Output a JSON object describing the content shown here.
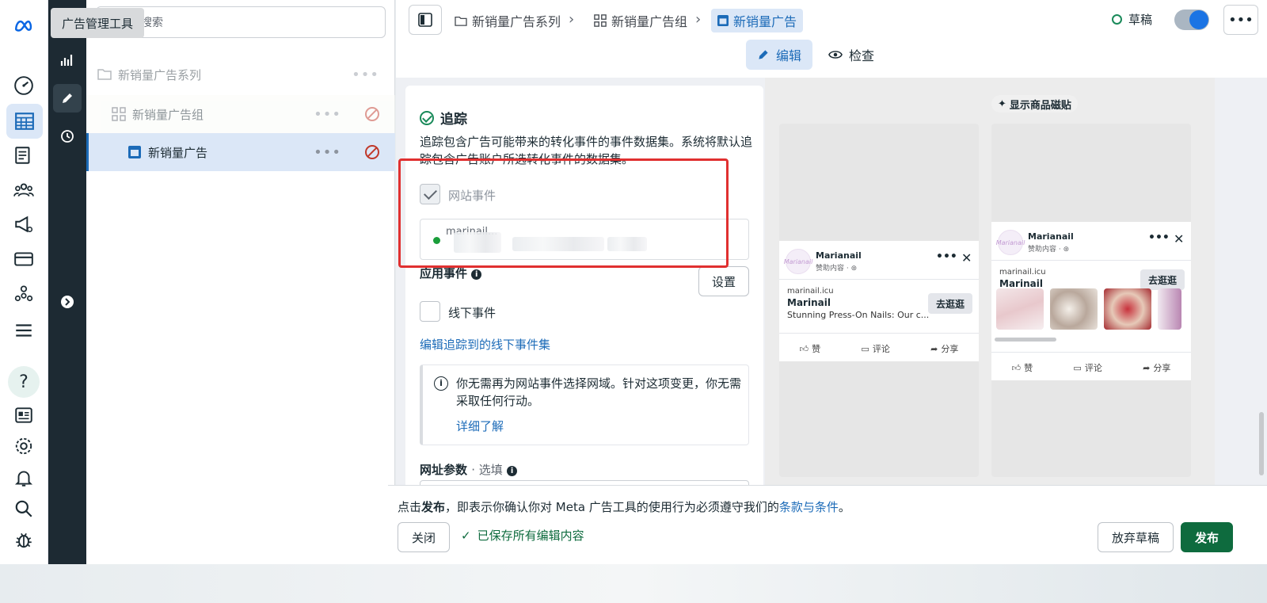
{
  "tooltip": "广告管理工具",
  "search": {
    "placeholder": "搜索"
  },
  "tree": {
    "campaign": "新销量广告系列",
    "adset": "新销量广告组",
    "ad": "新销量广告",
    "dots": "•••"
  },
  "breadcrumb": {
    "campaign": "新销量广告系列",
    "adset": "新销量广告组",
    "ad": "新销量广告"
  },
  "status": {
    "label": "草稿"
  },
  "more_label": "•••",
  "mode_tabs": {
    "edit": "编辑",
    "review": "检查"
  },
  "tracking": {
    "title": "追踪",
    "description": "追踪包含广告可能带来的转化事件的事件数据集。系统将默认追踪包含广告账户所选转化事件的数据集。",
    "website_events": "网站事件",
    "dataset_name": "marinail...",
    "app_events": "应用事件",
    "setup_button": "设置",
    "offline_events": "线下事件",
    "edit_offline_link": "编辑追踪到的线下事件集",
    "notice_text": "你无需再为网站事件选择网域。针对这项变更，你无需采取任何行动。",
    "learn_more": "详细了解",
    "url_params_label": "网址参数",
    "optional": "选填"
  },
  "preview": {
    "badge": "显示商品磁贴",
    "page_name": "Marianail",
    "page_name_2": "Marianail",
    "sponsored": "赞助内容 · ⊛",
    "avatar_text": "Marianail",
    "domain": "marinail.icu",
    "brand": "Marinail",
    "caption": "Stunning Press-On Nails: Our c...",
    "shop_button": "去逛逛",
    "like": "赞",
    "comment": "评论",
    "share": "分享"
  },
  "footer": {
    "terms_prefix": "点击",
    "terms_bold": "发布",
    "terms_middle": "，即表示你确认你对 Meta 广告工具的使用行为必须遵守我们的",
    "terms_link": "条款与条件",
    "terms_end": "。",
    "close": "关闭",
    "saved": "已保存所有编辑内容",
    "discard": "放弃草稿",
    "publish": "发布"
  },
  "colors": {
    "accent": "#1c6bb8",
    "publish": "#0e6b3e",
    "highlight": "#e03030"
  }
}
